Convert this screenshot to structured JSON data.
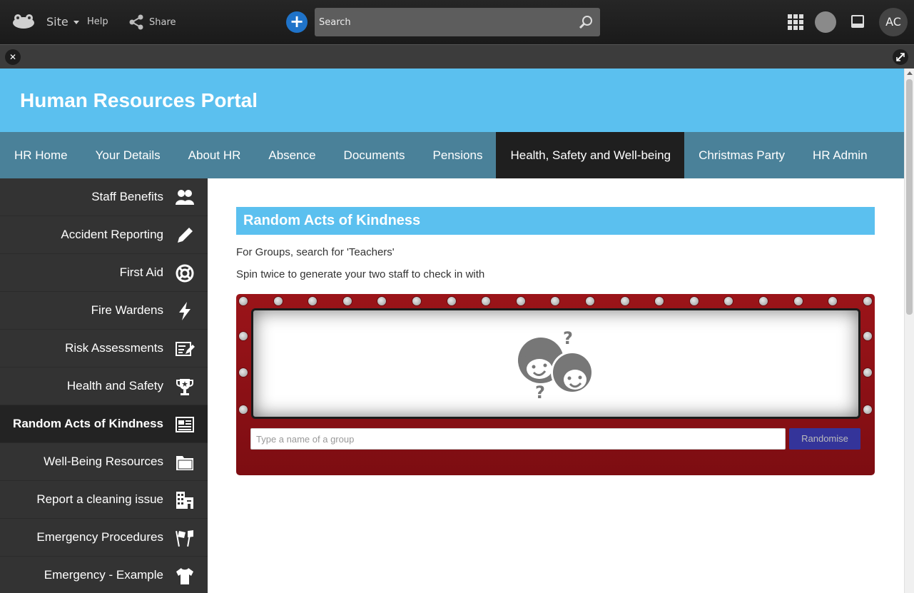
{
  "topbar": {
    "site_label": "Site",
    "help_label": "Help",
    "share_label": "Share",
    "search_placeholder": "Search",
    "user_initials": "AC"
  },
  "banner": {
    "title": "Human Resources Portal"
  },
  "nav": {
    "items": [
      {
        "label": "HR Home"
      },
      {
        "label": "Your Details"
      },
      {
        "label": "About HR"
      },
      {
        "label": "Absence"
      },
      {
        "label": "Documents"
      },
      {
        "label": "Pensions"
      },
      {
        "label": "Health, Safety and Well-being",
        "active": true
      },
      {
        "label": "Christmas Party"
      },
      {
        "label": "HR Admin"
      }
    ]
  },
  "sidebar": {
    "items": [
      {
        "label": "Staff Benefits",
        "icon": "users-icon"
      },
      {
        "label": "Accident Reporting",
        "icon": "pencil-icon"
      },
      {
        "label": "First Aid",
        "icon": "lifebuoy-icon"
      },
      {
        "label": "Fire Wardens",
        "icon": "lightning-icon"
      },
      {
        "label": "Risk Assessments",
        "icon": "form-edit-icon"
      },
      {
        "label": "Health and Safety",
        "icon": "trophy-icon"
      },
      {
        "label": "Random Acts of Kindness",
        "icon": "newspaper-icon",
        "active": true
      },
      {
        "label": "Well-Being Resources",
        "icon": "folder-icon"
      },
      {
        "label": "Report a cleaning issue",
        "icon": "building-icon"
      },
      {
        "label": "Emergency Procedures",
        "icon": "flags-icon"
      },
      {
        "label": "Emergency - Example",
        "icon": "tshirt-icon"
      }
    ]
  },
  "main": {
    "panel_title": "Random Acts of Kindness",
    "line1": "For Groups, search for 'Teachers'",
    "line2": "Spin twice to generate your two staff to check in with",
    "group_input_placeholder": "Type a name of a group",
    "randomise_label": "Randomise"
  },
  "colors": {
    "banner": "#5bc0ef",
    "nav": "#4a8199",
    "nav_active": "#1f1f1f",
    "sidebar": "#333333",
    "marquee": "#8c1016",
    "button": "#34349a"
  }
}
